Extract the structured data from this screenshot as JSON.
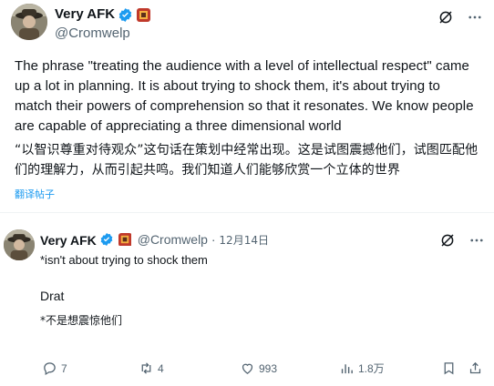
{
  "main_post": {
    "display_name": "Very AFK",
    "handle": "@Cromwelp",
    "text": "The phrase \"treating the audience with a level of intellectual respect\" came up a lot in planning. It is about trying to shock them, it's about trying to match their powers of comprehension so that it resonates. We know people are capable of appreciating a three dimensional world",
    "translation": "“以智识尊重对待观众”这句话在策划中经常出现。这是试图震撼他们，试图匹配他们的理解力，从而引起共鸣。我们知道人们能够欣赏一个立体的世界",
    "translate_link": "翻译帖子"
  },
  "reply": {
    "display_name": "Very AFK",
    "handle": "@Cromwelp",
    "separator": "·",
    "date": "12月14日",
    "line1": "*isn't about trying to shock them",
    "line2": "Drat",
    "line3": "*不是想震惊他们",
    "stats": {
      "replies": "7",
      "reposts": "4",
      "likes": "993",
      "views": "1.8万"
    }
  },
  "colors": {
    "accent": "#1d9bf0",
    "muted": "#536471",
    "divider": "#eff3f4"
  },
  "icons": {
    "verified": "verified-badge-icon",
    "grok": "grok-icon",
    "more": "more-icon",
    "reply": "reply-icon",
    "repost": "repost-icon",
    "like": "like-icon",
    "views": "views-icon",
    "bookmark": "bookmark-icon",
    "share": "share-icon"
  }
}
